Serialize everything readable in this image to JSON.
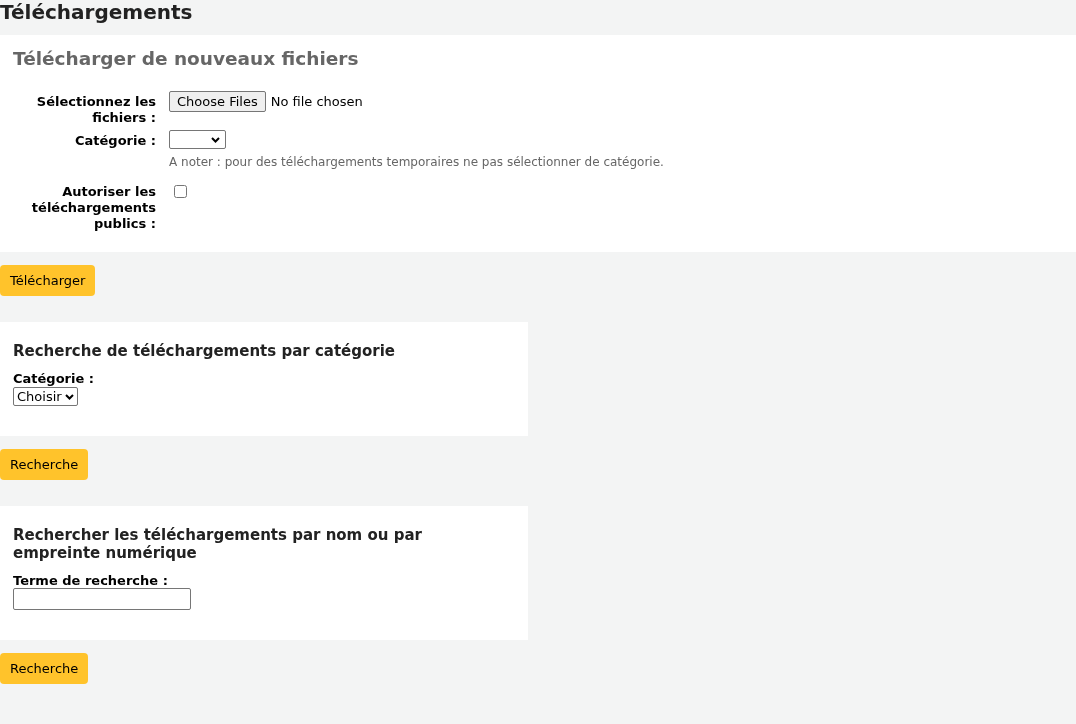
{
  "page_title": "Téléchargements",
  "upload": {
    "heading": "Télécharger de nouveaux fichiers",
    "files_label": "Sélectionnez les fichiers :",
    "file_button": "Choose Files",
    "file_status": "No file chosen",
    "category_label": "Catégorie :",
    "hint": "A noter : pour des téléchargements temporaires ne pas sélectionner de catégorie.",
    "public_label": "Autoriser les téléchargements publics :",
    "public_checked": false,
    "submit": "Télécharger"
  },
  "search_category": {
    "heading": "Recherche de téléchargements par catégorie",
    "label": "Catégorie :",
    "value": "Choisir",
    "submit": "Recherche"
  },
  "search_term": {
    "heading": "Rechercher les téléchargements par nom ou par empreinte numérique",
    "label": "Terme de recherche :",
    "submit": "Recherche"
  }
}
